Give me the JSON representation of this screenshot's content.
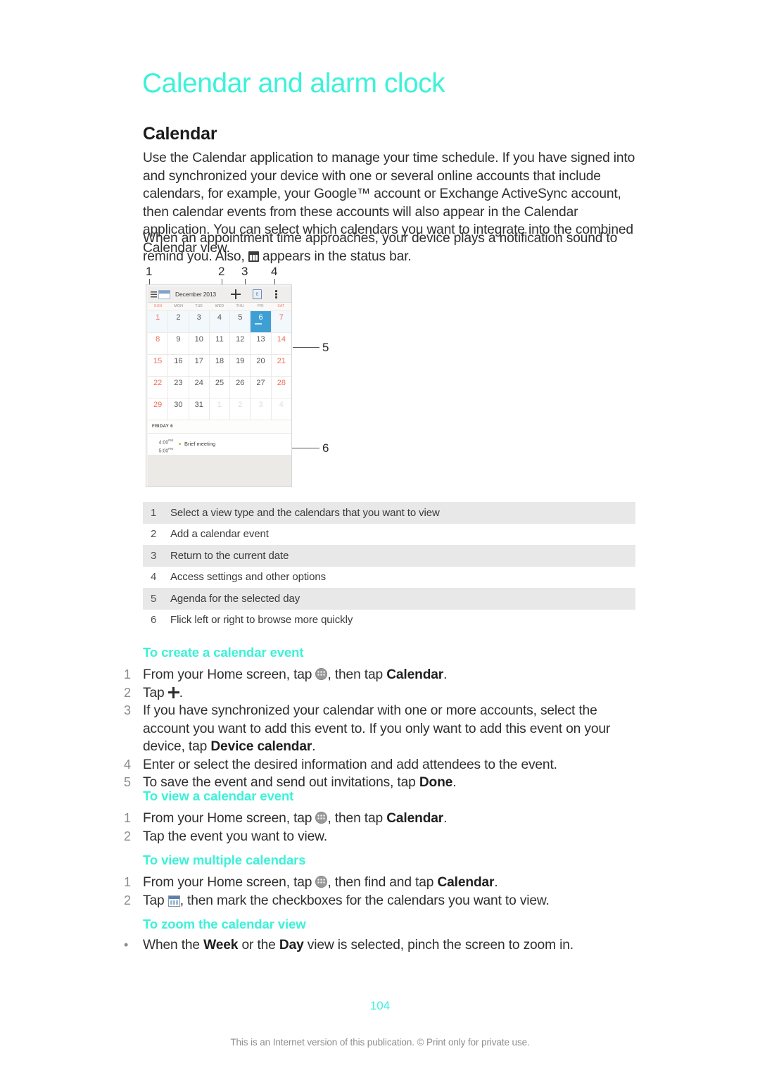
{
  "document": {
    "title": "Calendar and alarm clock",
    "section_heading": "Calendar",
    "page_number": "104",
    "footnote": "This is an Internet version of this publication. © Print only for private use.",
    "accent_color": "#3CF2D9"
  },
  "intro": {
    "paragraph_1": "Use the Calendar application to manage your time schedule. If you have signed into and synchronized your device with one or several online accounts that include calendars, for example, your Google™ account or Exchange ActiveSync account, then calendar events from these accounts will also appear in the Calendar application. You can select which calendars you want to integrate into the combined Calendar view.",
    "paragraph_2_before_icon": "When an appointment time approaches, your device plays a notification sound to remind you. Also,",
    "paragraph_2_after_icon": "appears in the status bar.",
    "status_bar_icon": "calendar-status-icon"
  },
  "figure": {
    "callouts": [
      "1",
      "2",
      "3",
      "4",
      "5",
      "6"
    ],
    "phone": {
      "toolbar": {
        "menu_icon": "hamburger-icon",
        "calendar_icon": "calendar-view-icon",
        "month_label": "December 2013",
        "add_icon": "plus-icon",
        "today_label": "6",
        "overflow_icon": "overflow-menu-icon"
      },
      "weekdays": [
        "SUN",
        "MON",
        "TUE",
        "WED",
        "THU",
        "FRI",
        "SAT"
      ],
      "weeks": [
        [
          {
            "d": "1",
            "k": "weekend"
          },
          {
            "d": "2",
            "k": "day"
          },
          {
            "d": "3",
            "k": "day"
          },
          {
            "d": "4",
            "k": "day"
          },
          {
            "d": "5",
            "k": "day"
          },
          {
            "d": "6",
            "k": "selected"
          },
          {
            "d": "7",
            "k": "weekend"
          }
        ],
        [
          {
            "d": "8",
            "k": "weekend"
          },
          {
            "d": "9",
            "k": "day"
          },
          {
            "d": "10",
            "k": "day"
          },
          {
            "d": "11",
            "k": "day"
          },
          {
            "d": "12",
            "k": "day"
          },
          {
            "d": "13",
            "k": "day"
          },
          {
            "d": "14",
            "k": "weekend"
          }
        ],
        [
          {
            "d": "15",
            "k": "weekend"
          },
          {
            "d": "16",
            "k": "day"
          },
          {
            "d": "17",
            "k": "day"
          },
          {
            "d": "18",
            "k": "day"
          },
          {
            "d": "19",
            "k": "day"
          },
          {
            "d": "20",
            "k": "day"
          },
          {
            "d": "21",
            "k": "weekend"
          }
        ],
        [
          {
            "d": "22",
            "k": "weekend"
          },
          {
            "d": "23",
            "k": "day"
          },
          {
            "d": "24",
            "k": "day"
          },
          {
            "d": "25",
            "k": "day"
          },
          {
            "d": "26",
            "k": "day"
          },
          {
            "d": "27",
            "k": "day"
          },
          {
            "d": "28",
            "k": "weekend"
          }
        ],
        [
          {
            "d": "29",
            "k": "weekend"
          },
          {
            "d": "30",
            "k": "day"
          },
          {
            "d": "31",
            "k": "day"
          },
          {
            "d": "1",
            "k": "dim"
          },
          {
            "d": "2",
            "k": "dim"
          },
          {
            "d": "3",
            "k": "dim"
          },
          {
            "d": "4",
            "k": "dim"
          }
        ]
      ],
      "agenda": {
        "day_header": "FRIDAY 6",
        "event_start": "4:00",
        "event_start_meridiem": "PM",
        "event_end": "5:00",
        "event_end_meridiem": "PM",
        "event_title": "Brief meeting"
      }
    }
  },
  "legend": [
    {
      "num": "1",
      "text": "Select a view type and the calendars that you want to view"
    },
    {
      "num": "2",
      "text": "Add a calendar event"
    },
    {
      "num": "3",
      "text": "Return to the current date"
    },
    {
      "num": "4",
      "text": "Access settings and other options"
    },
    {
      "num": "5",
      "text": "Agenda for the selected day"
    },
    {
      "num": "6",
      "text": "Flick left or right to browse more quickly"
    }
  ],
  "sections": {
    "create_event": {
      "title": "To create a calendar event",
      "s1_a": "From your Home screen, tap",
      "s1_b": ", then tap",
      "s1_bold": "Calendar",
      "s1_c": ".",
      "s2_a": "Tap",
      "s2_b": ".",
      "s3_a": "If you have synchronized your calendar with one or more accounts, select the account you want to add this event to. If you only want to add this event on your device, tap",
      "s3_bold": "Device calendar",
      "s3_b": ".",
      "s4": "Enter or select the desired information and add attendees to the event.",
      "s5_a": "To save the event and send out invitations, tap",
      "s5_bold": "Done",
      "s5_b": ".",
      "numbers": [
        "1",
        "2",
        "3",
        "4",
        "5"
      ]
    },
    "view_event": {
      "title": "To view a calendar event",
      "s1_a": "From your Home screen, tap",
      "s1_b": ", then tap",
      "s1_bold": "Calendar",
      "s1_c": ".",
      "s2": "Tap the event you want to view.",
      "numbers": [
        "1",
        "2"
      ]
    },
    "multiple_calendars": {
      "title": "To view multiple calendars",
      "s1_a": "From your Home screen, tap",
      "s1_b": ", then find and tap",
      "s1_bold": "Calendar",
      "s1_c": ".",
      "s2_a": "Tap",
      "s2_b": ", then mark the checkboxes for the calendars you want to view.",
      "numbers": [
        "1",
        "2"
      ]
    },
    "zoom_view": {
      "title": "To zoom the calendar view",
      "bullet": "•",
      "b1_a": "When the",
      "b1_bold1": "Week",
      "b1_b": "or the",
      "b1_bold2": "Day",
      "b1_c": "view is selected, pinch the screen to zoom in."
    }
  }
}
